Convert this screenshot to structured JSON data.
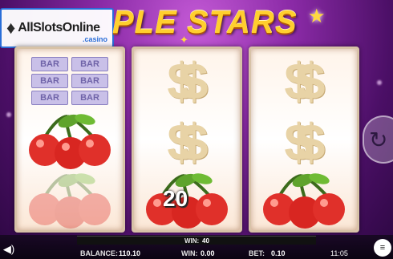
{
  "logo": {
    "brand": "AllSlotsOnline",
    "domain": ".casino",
    "icon": "diamond-icon"
  },
  "title": {
    "text": "PLE STARS",
    "icon": "star-icon"
  },
  "reels": [
    {
      "symbols": [
        {
          "type": "bar-triple",
          "labels": [
            "BAR",
            "BAR",
            "BAR",
            "BAR",
            "BAR",
            "BAR"
          ],
          "dimmed": false
        },
        {
          "type": "cherries",
          "icon": "cherries-icon",
          "dimmed": false
        },
        {
          "type": "cherries",
          "icon": "cherries-icon",
          "dimmed": true
        }
      ]
    },
    {
      "symbols": [
        {
          "type": "dollar",
          "text": "$$",
          "dimmed": false
        },
        {
          "type": "dollar",
          "text": "$$",
          "dimmed": false
        },
        {
          "type": "cherries",
          "icon": "cherries-icon",
          "dimmed": false
        }
      ]
    },
    {
      "symbols": [
        {
          "type": "dollar",
          "text": "$$",
          "dimmed": false
        },
        {
          "type": "dollar",
          "text": "$$",
          "dimmed": false
        },
        {
          "type": "cherries",
          "icon": "cherries-icon",
          "dimmed": false
        }
      ]
    }
  ],
  "win_display": "20",
  "bottom": {
    "win_line_label": "WIN:",
    "win_line_value": "40",
    "balance_label": "BALANCE:",
    "balance_value": "110.10",
    "win_label": "WIN:",
    "win_value": "0.00",
    "bet_label": "BET:",
    "bet_value": "0.10",
    "clock": "11:05"
  },
  "controls": {
    "spin_icon": "refresh-icon",
    "sound_icon": "speaker-icon",
    "menu_icon": "menu-icon"
  }
}
